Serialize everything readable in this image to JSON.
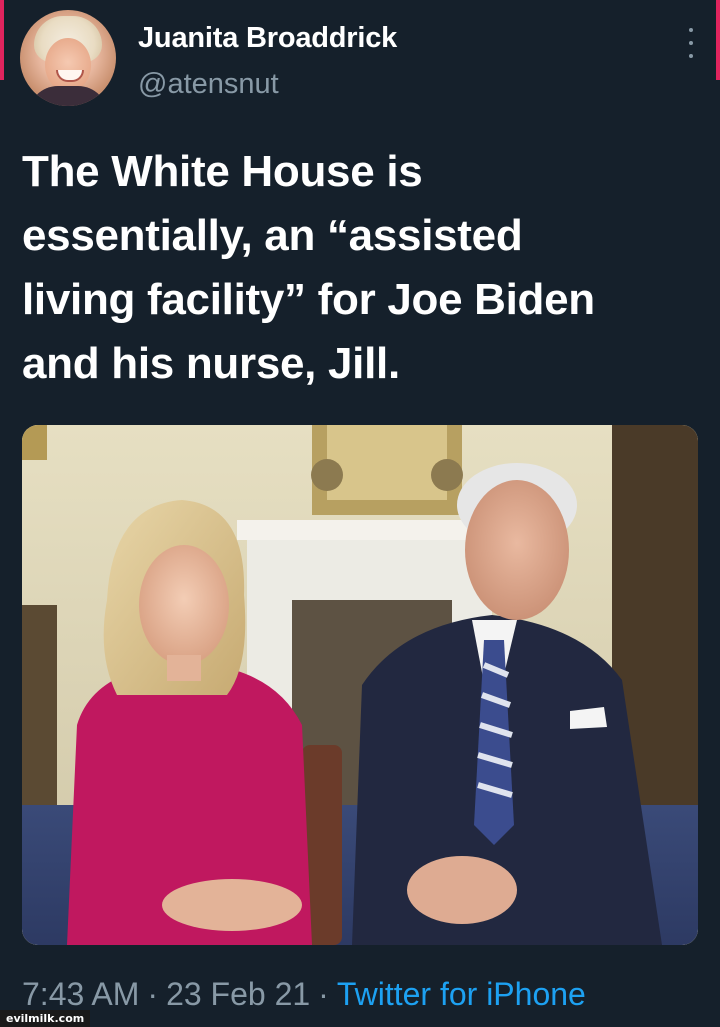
{
  "tweet": {
    "author_name": "Juanita Broaddrick",
    "author_handle": "@atensnut",
    "text": "The White House is\nessentially, an “assisted\nliving facility” for Joe Biden\nand his nurse, Jill.",
    "time": "7:43 AM",
    "date": "23 Feb 21",
    "separator": "·",
    "source": "Twitter for iPhone",
    "more_icon": "more-vertical-icon"
  },
  "watermark": "evilmilk.com",
  "colors": {
    "background": "#15202b",
    "secondary_text": "#8899a6",
    "link": "#1da1f2",
    "accent_edge": "#e0245e"
  }
}
